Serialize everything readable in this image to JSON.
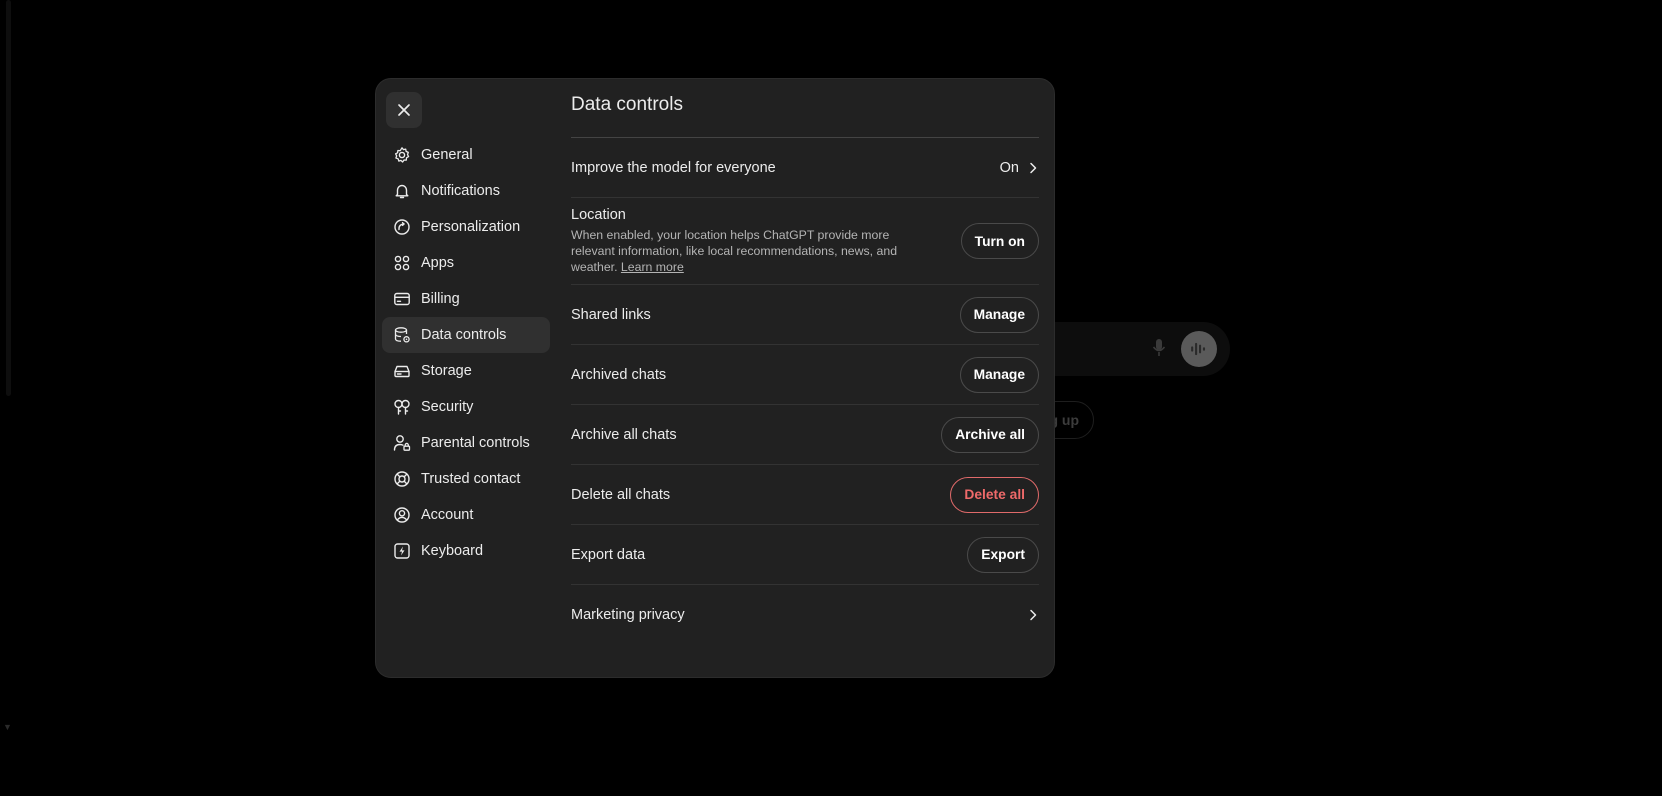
{
  "modal": {
    "title": "Data controls",
    "close_icon": "close-icon"
  },
  "sidebar": {
    "items": [
      {
        "label": "General",
        "icon": "gear-icon"
      },
      {
        "label": "Notifications",
        "icon": "bell-icon"
      },
      {
        "label": "Personalization",
        "icon": "personalization-icon"
      },
      {
        "label": "Apps",
        "icon": "apps-grid-icon"
      },
      {
        "label": "Billing",
        "icon": "credit-card-icon"
      },
      {
        "label": "Data controls",
        "icon": "database-gear-icon",
        "active": true
      },
      {
        "label": "Storage",
        "icon": "storage-drive-icon"
      },
      {
        "label": "Security",
        "icon": "security-key-icon"
      },
      {
        "label": "Parental controls",
        "icon": "parental-person-lock-icon"
      },
      {
        "label": "Trusted contact",
        "icon": "lifebuoy-icon"
      },
      {
        "label": "Account",
        "icon": "user-circle-icon"
      },
      {
        "label": "Keyboard",
        "icon": "keyboard-bolt-icon"
      }
    ]
  },
  "settings": {
    "improve_model": {
      "label": "Improve the model for everyone",
      "value": "On"
    },
    "location": {
      "title": "Location",
      "description": "When enabled, your location helps ChatGPT provide more relevant information, like local recommendations, news, and weather.",
      "link": "Learn more",
      "button": "Turn on"
    },
    "shared_links": {
      "label": "Shared links",
      "button": "Manage"
    },
    "archived_chats": {
      "label": "Archived chats",
      "button": "Manage"
    },
    "archive_all": {
      "label": "Archive all chats",
      "button": "Archive all"
    },
    "delete_all": {
      "label": "Delete all chats",
      "button": "Delete all"
    },
    "export_data": {
      "label": "Export data",
      "button": "Export"
    },
    "marketing_privacy": {
      "label": "Marketing privacy"
    }
  },
  "background": {
    "signup_fragment": "g up"
  },
  "colors": {
    "modal_bg": "#212121",
    "danger": "#ef6a6a",
    "active_item_bg": "#303030"
  }
}
